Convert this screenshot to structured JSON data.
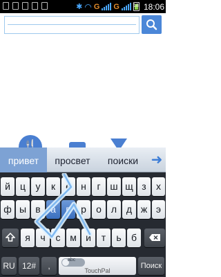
{
  "status_bar": {
    "network_label_1": "G",
    "network_label_2": "G",
    "battery_level": "18",
    "time": "18:06"
  },
  "search": {
    "value": "",
    "placeholder": ""
  },
  "keyboard": {
    "suggestions": [
      "привет",
      "просвет",
      "поиски"
    ],
    "row1": [
      "й",
      "ц",
      "у",
      "к",
      "е",
      "н",
      "г",
      "ш",
      "щ",
      "з",
      "х"
    ],
    "row2": [
      "ф",
      "ы",
      "в",
      "а",
      "п",
      "р",
      "о",
      "л",
      "д",
      "ж",
      "э"
    ],
    "row3": [
      "я",
      "ч",
      "с",
      "м",
      "и",
      "т",
      "ь",
      "б",
      "ю"
    ],
    "lang_key": "RU",
    "num_key": "12#",
    "comma_key": ",",
    "period_key": ".",
    "space_toggle_label": "abc",
    "space_brand": "TouchPal",
    "search_key": "Поиск"
  },
  "colors": {
    "accent": "#4b87d8",
    "keyboard_bg": "#262a31",
    "highlight_key": "#5a86c9"
  }
}
